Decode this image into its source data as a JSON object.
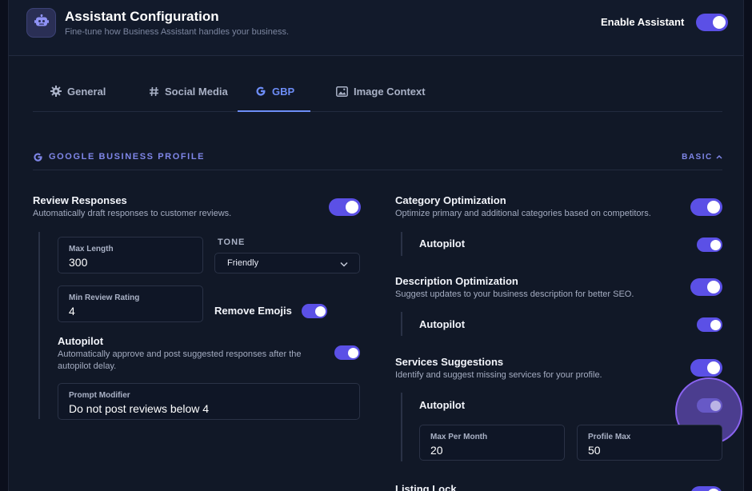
{
  "header": {
    "title": "Assistant Configuration",
    "subtitle": "Fine-tune how Business Assistant handles your business.",
    "enable_label": "Enable Assistant",
    "enabled": true,
    "logo_icon": "robot-icon"
  },
  "tabs": [
    {
      "label": "General",
      "icon": "gear-icon",
      "active": false
    },
    {
      "label": "Social Media",
      "icon": "hashtag-icon",
      "active": false
    },
    {
      "label": "GBP",
      "icon": "google-g-icon",
      "active": true
    },
    {
      "label": "Image Context",
      "icon": "image-icon",
      "active": false
    }
  ],
  "section": {
    "title": "GOOGLE BUSINESS PROFILE",
    "mode": "BASIC",
    "icon": "google-g-icon"
  },
  "review": {
    "title": "Review Responses",
    "desc": "Automatically draft responses to customer reviews.",
    "enabled": true,
    "max_length_label": "Max Length",
    "max_length": "300",
    "tone_label": "TONE",
    "tone_value": "Friendly",
    "min_rating_label": "Min Review Rating",
    "min_rating": "4",
    "remove_emojis_label": "Remove Emojis",
    "remove_emojis": true,
    "autopilot_title": "Autopilot",
    "autopilot_desc": "Automatically approve and post suggested responses after the autopilot delay.",
    "autopilot": true,
    "prompt_label": "Prompt Modifier",
    "prompt_value": "Do not post reviews below 4"
  },
  "category": {
    "title": "Category Optimization",
    "desc": "Optimize primary and additional categories based on competitors.",
    "enabled": true,
    "autopilot_label": "Autopilot",
    "autopilot": true
  },
  "description": {
    "title": "Description Optimization",
    "desc": "Suggest updates to your business description for better SEO.",
    "enabled": true,
    "autopilot_label": "Autopilot",
    "autopilot": true
  },
  "services": {
    "title": "Services Suggestions",
    "desc": "Identify and suggest missing services for your profile.",
    "enabled": true,
    "autopilot_label": "Autopilot",
    "autopilot": true,
    "max_per_month_label": "Max Per Month",
    "max_per_month": "20",
    "profile_max_label": "Profile Max",
    "profile_max": "50"
  },
  "listing": {
    "title": "Listing Lock",
    "enabled": true
  },
  "colors": {
    "accent": "#5b50e6",
    "active_tab": "#6d8df7",
    "section_title": "#7f86e8",
    "background": "#111827"
  }
}
